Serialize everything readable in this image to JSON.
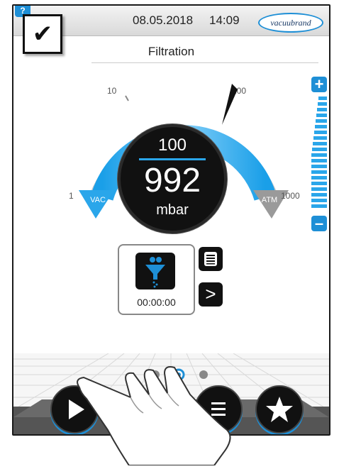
{
  "topbar": {
    "help_label": "?",
    "date": "08.05.2018",
    "time": "14:09",
    "brand": "vacuubrand"
  },
  "confirm": {
    "symbol": "✔"
  },
  "page_title": "Filtration",
  "gauge": {
    "ticks": {
      "t1": "1",
      "t10": "10",
      "t100": "100",
      "t1000": "1000"
    },
    "vac_label": "VAC",
    "atm_label": "ATM",
    "setpoint": "100",
    "pressure": "992",
    "unit": "mbar"
  },
  "side_controls": {
    "plus": "+",
    "minus": "–"
  },
  "process": {
    "timer": "00:00:00",
    "next_symbol": ">"
  },
  "bottom": {
    "page_count": 3,
    "active_page": 2
  },
  "colors": {
    "accent": "#1e8fd6",
    "arc_light": "#8fd4fb",
    "arc_dark": "#1a9fe8",
    "vac_marker": "#2aa6ea",
    "atm_marker": "#9a9a9a"
  },
  "icons": [
    "checkmark-icon",
    "funnel-icon",
    "list-icon",
    "chevron-right-icon",
    "play-icon",
    "star-icon",
    "hand-pointer-icon"
  ]
}
